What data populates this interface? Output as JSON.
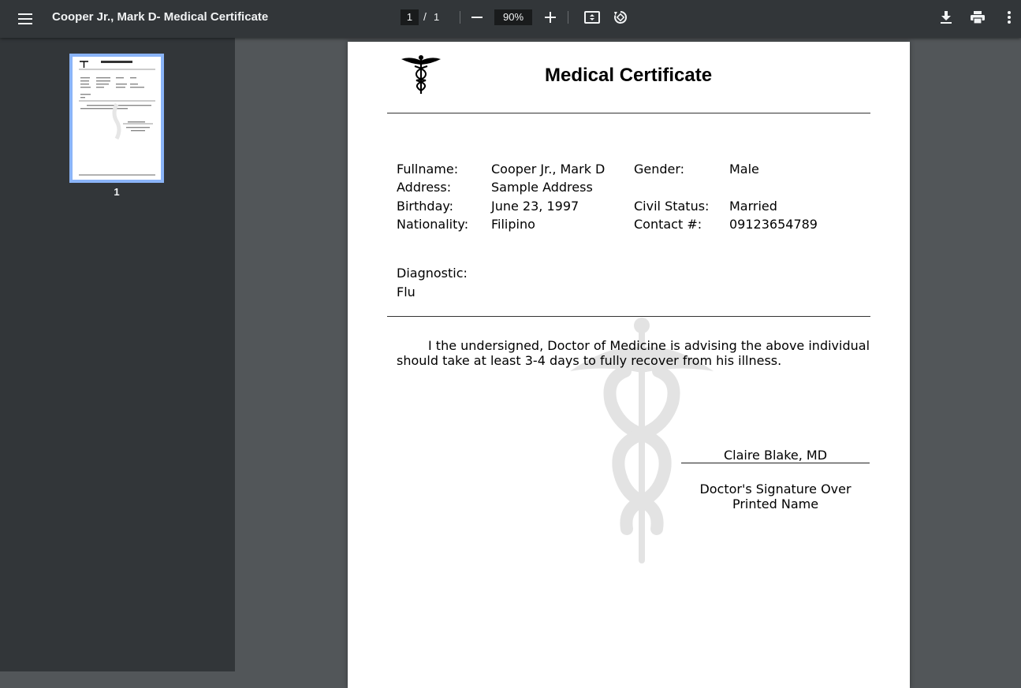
{
  "toolbar": {
    "title": "Cooper Jr., Mark D- Medical Certificate",
    "current_page": "1",
    "page_separator": "/",
    "total_pages": "1",
    "zoom": "90%"
  },
  "sidebar": {
    "thumbnail_label": "1"
  },
  "certificate": {
    "title": "Medical Certificate",
    "fields": {
      "fullname_label": "Fullname:",
      "fullname_value": "Cooper Jr., Mark D",
      "address_label": "Address:",
      "address_value": "Sample Address",
      "birthday_label": "Birthday:",
      "birthday_value": "June 23, 1997",
      "nationality_label": "Nationality:",
      "nationality_value": "Filipino",
      "gender_label": "Gender:",
      "gender_value": "Male",
      "civil_label": "Civil Status:",
      "civil_value": "Married",
      "contact_label": "Contact #:",
      "contact_value": "09123654789"
    },
    "diagnostic_label": "Diagnostic:",
    "diagnostic_value": "Flu",
    "body": "I the undersigned, Doctor of Medicine is advising the above individual should take at least 3-4 days to fully recover from his illness.",
    "doctor_name": "Claire Blake, MD",
    "signature_caption_1": "Doctor's Signature Over",
    "signature_caption_2": "Printed Name"
  },
  "icons": {
    "menu": "menu-icon",
    "zoom_out": "minus-icon",
    "zoom_in": "plus-icon",
    "fit": "fit-page-icon",
    "rotate": "rotate-icon",
    "download": "download-icon",
    "print": "print-icon",
    "more": "more-vert-icon",
    "logo": "caduceus-icon"
  }
}
